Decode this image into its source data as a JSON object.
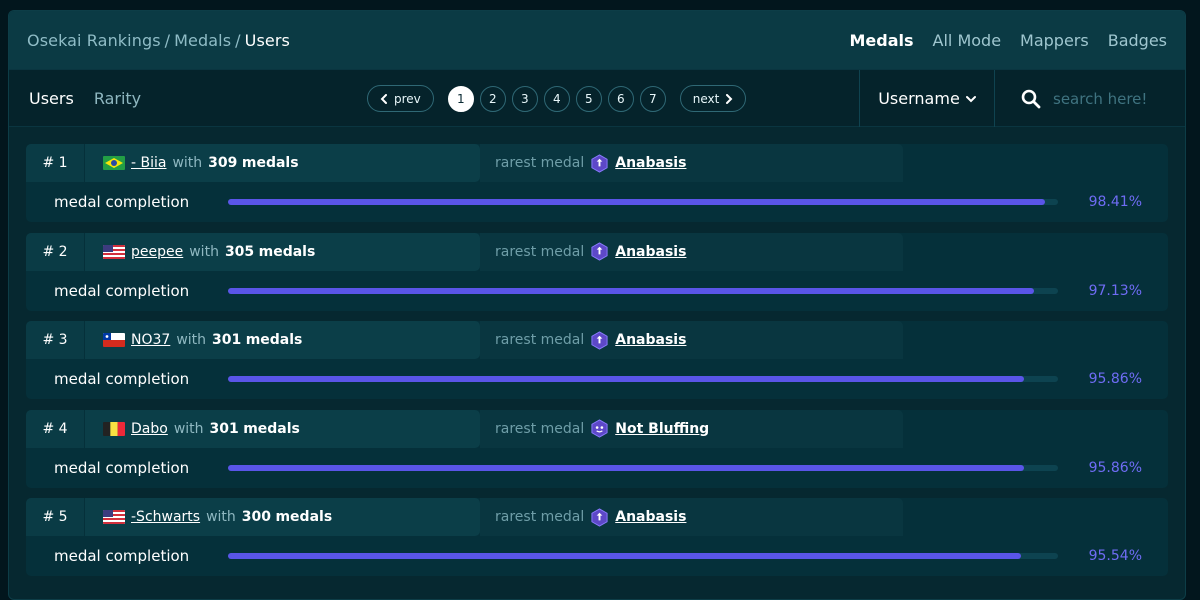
{
  "header": {
    "breadcrumb": [
      "Osekai Rankings",
      "Medals",
      "Users"
    ],
    "nav": [
      "Medals",
      "All Mode",
      "Mappers",
      "Badges"
    ]
  },
  "subnav": {
    "tabs": [
      "Users",
      "Rarity"
    ],
    "prev_label": "prev",
    "next_label": "next",
    "pages": [
      "1",
      "2",
      "3",
      "4",
      "5",
      "6",
      "7"
    ],
    "current_page": "1",
    "sort_label": "Username",
    "search_placeholder": "search here!"
  },
  "labels": {
    "with": "with",
    "medals": "medals",
    "rarest": "rarest medal",
    "completion": "medal completion"
  },
  "colors": {
    "accent": "#5a55e8",
    "percent_text": "#6f6cf4",
    "medal_icon": "#5d48c8"
  },
  "rows": [
    {
      "rank": "# 1",
      "flag": "brazil",
      "username": "- Biia",
      "medal_count": "309",
      "rarest_medal": "Anabasis",
      "medal_icon": "anabasis-medal-icon",
      "completion": 98.41,
      "completion_text": "98.41%"
    },
    {
      "rank": "# 2",
      "flag": "usa",
      "username": "peepee",
      "medal_count": "305",
      "rarest_medal": "Anabasis",
      "medal_icon": "anabasis-medal-icon",
      "completion": 97.13,
      "completion_text": "97.13%"
    },
    {
      "rank": "# 3",
      "flag": "chile",
      "username": "NO37",
      "medal_count": "301",
      "rarest_medal": "Anabasis",
      "medal_icon": "anabasis-medal-icon",
      "completion": 95.86,
      "completion_text": "95.86%"
    },
    {
      "rank": "# 4",
      "flag": "belgium",
      "username": "Dabo",
      "medal_count": "301",
      "rarest_medal": "Not Bluffing",
      "medal_icon": "not-bluffing-medal-icon",
      "completion": 95.86,
      "completion_text": "95.86%"
    },
    {
      "rank": "# 5",
      "flag": "usa",
      "username": "-Schwarts",
      "medal_count": "300",
      "rarest_medal": "Anabasis",
      "medal_icon": "anabasis-medal-icon",
      "completion": 95.54,
      "completion_text": "95.54%"
    }
  ]
}
